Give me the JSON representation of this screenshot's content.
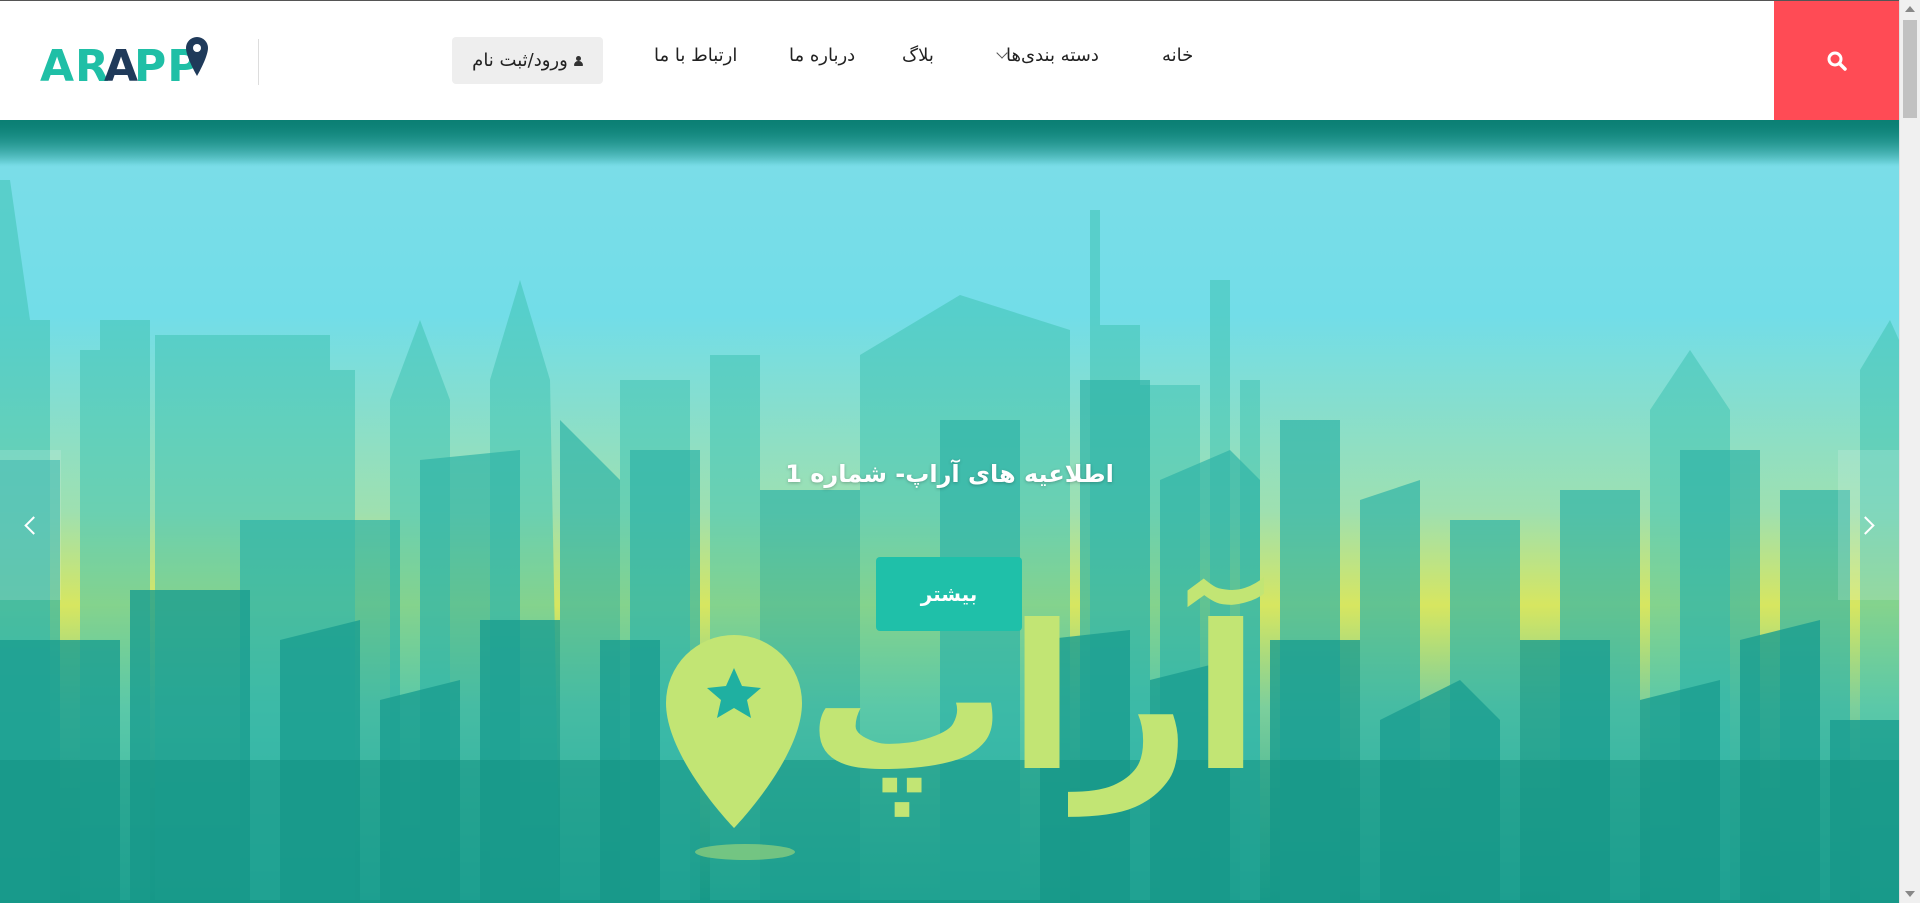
{
  "header": {
    "logo_text": "ARAPP",
    "nav": {
      "home": "خانه",
      "categories": "دسته بندی‌ها",
      "blog": "بلاگ",
      "about": "درباره ما",
      "contact": "ارتباط با ما"
    },
    "login_label": "ورود/ثبت نام",
    "search_icon": "search-icon",
    "search_color": "#ff4b55"
  },
  "slider": {
    "title": "اطلاعیه های آراپ- شماره 1",
    "button_label": "بیشتر",
    "logo_text": "آراپ",
    "button_color": "#1fc0a9"
  }
}
